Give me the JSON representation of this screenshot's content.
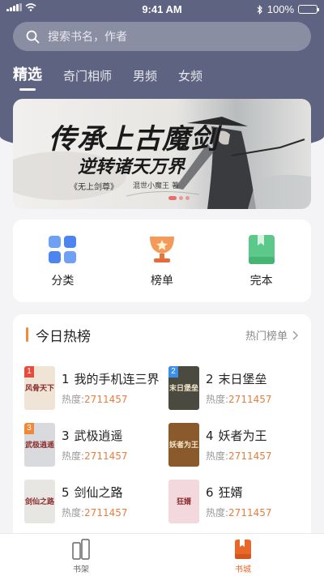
{
  "status_bar": {
    "time": "9:41 AM",
    "battery": "100%",
    "battery_level": 1.0
  },
  "search": {
    "placeholder": "搜索书名，作者"
  },
  "tabs": [
    {
      "label": "精选",
      "active": true
    },
    {
      "label": "奇门相师",
      "active": false
    },
    {
      "label": "男频",
      "active": false
    },
    {
      "label": "女频",
      "active": false
    }
  ],
  "banner": {
    "headline": "传承上古魔剑",
    "subline": "逆转诸天万界",
    "book_title": "《无上剑尊》",
    "author": "混世小魔王 著"
  },
  "categories": [
    {
      "label": "分类",
      "icon": "grid-icon"
    },
    {
      "label": "榜单",
      "icon": "trophy-icon"
    },
    {
      "label": "完本",
      "icon": "book-icon"
    }
  ],
  "hot": {
    "title": "今日热榜",
    "more_label": "热门榜单",
    "items": [
      {
        "rank": "1",
        "name": "我的手机连三界",
        "heat_label": "热度:",
        "heat_value": "2711457",
        "cover_text": "风骨天下",
        "rank_color": "#e84b3c",
        "cover_color": "#efe4d6"
      },
      {
        "rank": "2",
        "name": "末日堡垒",
        "heat_label": "热度:",
        "heat_value": "2711457",
        "cover_text": "末日堡垒",
        "rank_color": "#3c8fe8",
        "cover_color": "#4a4a40"
      },
      {
        "rank": "3",
        "name": "武极逍遥",
        "heat_label": "热度:",
        "heat_value": "2711457",
        "cover_text": "武极逍遥",
        "rank_color": "#f0883a",
        "cover_color": "#d9dadd"
      },
      {
        "rank": "4",
        "name": "妖者为王",
        "heat_label": "热度:",
        "heat_value": "2711457",
        "cover_text": "妖者为王",
        "rank_color": "",
        "cover_color": "#8a5a2c"
      },
      {
        "rank": "5",
        "name": "剑仙之路",
        "heat_label": "热度:",
        "heat_value": "2711457",
        "cover_text": "剑仙之路",
        "rank_color": "",
        "cover_color": "#e8e6e2"
      },
      {
        "rank": "6",
        "name": "狂婿",
        "heat_label": "热度:",
        "heat_value": "2711457",
        "cover_text": "狂婿",
        "rank_color": "",
        "cover_color": "#f3d9de"
      }
    ]
  },
  "tabbar": [
    {
      "label": "书架",
      "icon": "bookshelf-icon",
      "active": false
    },
    {
      "label": "书城",
      "icon": "bookstore-icon",
      "active": true
    }
  ],
  "colors": {
    "header": "#5d6380",
    "accent": "#e8682a",
    "heat": "#e87d3e"
  }
}
